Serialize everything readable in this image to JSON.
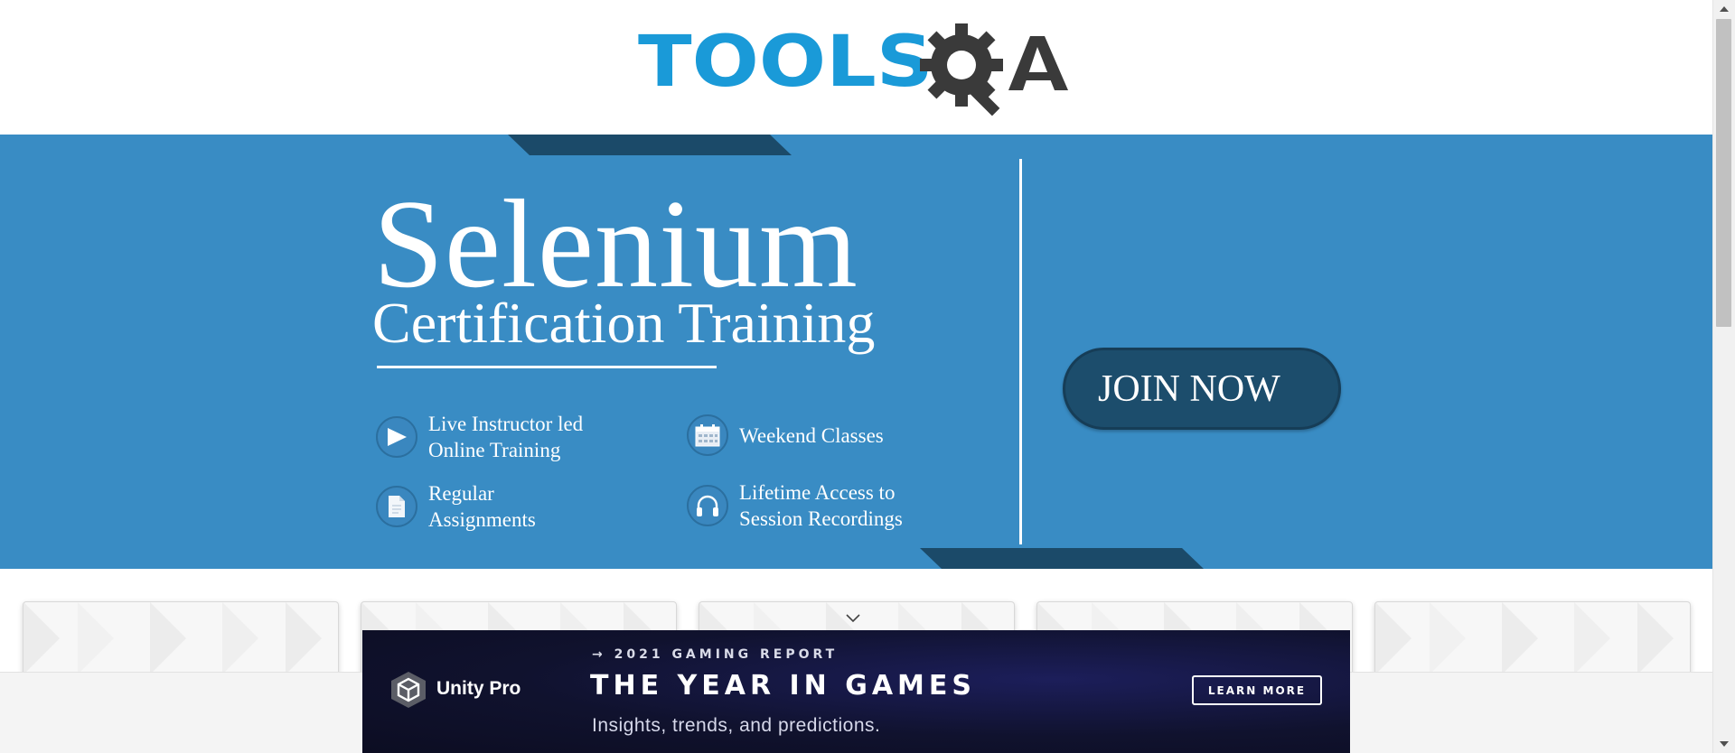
{
  "header": {
    "logo": {
      "text_tools": "TOOLS",
      "text_qa": "QA",
      "colors": {
        "tools": "#1a9ad8",
        "qa": "#3a3a3a"
      }
    }
  },
  "banner": {
    "background": "#398cc4",
    "title": "Selenium",
    "subtitle": "Certification Training",
    "features": [
      {
        "icon": "play-icon",
        "line1": "Live Instructor led",
        "line2": "Online Training"
      },
      {
        "icon": "calendar-icon",
        "line1": "Weekend Classes",
        "line2": ""
      },
      {
        "icon": "document-icon",
        "line1": "Regular",
        "line2": "Assignments"
      },
      {
        "icon": "headphones-icon",
        "line1": "Lifetime Access to",
        "line2": "Session Recordings"
      }
    ],
    "cta_label": "JOIN NOW"
  },
  "cards": {
    "count": 5
  },
  "ad": {
    "brand": "Unity Pro",
    "kicker": "→ 2021 GAMING REPORT",
    "headline": "THE YEAR IN GAMES",
    "subline": "Insights, trends, and predictions.",
    "button_label": "LEARN MORE"
  }
}
